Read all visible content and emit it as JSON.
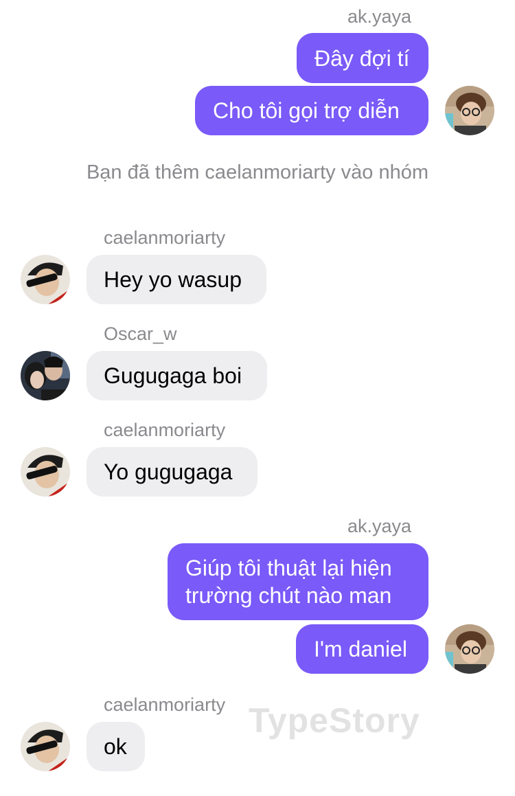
{
  "messages": [
    {
      "sender": "ak.yaya",
      "text": "Đây đợi tí"
    },
    {
      "text": "Cho tôi gọi trợ diễn"
    },
    {
      "text": "Bạn đã thêm caelanmoriarty vào nhóm"
    },
    {
      "sender": "caelanmoriarty",
      "text": "Hey yo wasup"
    },
    {
      "sender": "Oscar_w",
      "text": "Gugugaga boi"
    },
    {
      "sender": "caelanmoriarty",
      "text": "Yo gugugaga"
    },
    {
      "sender": "ak.yaya",
      "text_line1": "Giúp tôi thuật lại hiện",
      "text_line2": "trường chút nào man"
    },
    {
      "text": "I'm daniel"
    },
    {
      "sender": "caelanmoriarty",
      "text": "ok"
    }
  ],
  "watermark": "TypeStory",
  "colors": {
    "outgoing_bubble": "#7a5af8",
    "incoming_bubble": "#eeeef0",
    "meta_text": "#8a8a8e"
  }
}
